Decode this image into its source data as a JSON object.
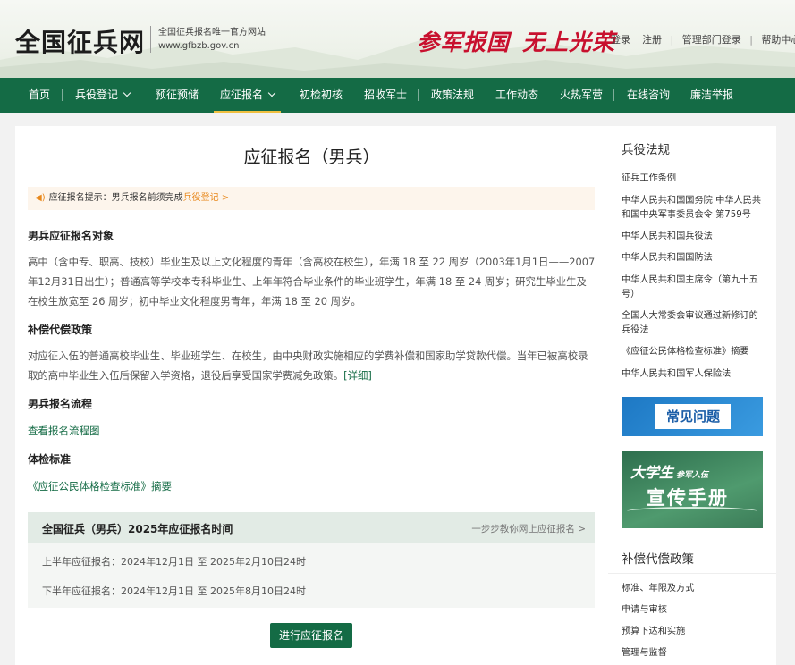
{
  "header": {
    "site_title": "全国征兵网",
    "site_sub1": "全国征兵报名唯一官方网站",
    "site_sub2": "www.gfbzb.gov.cn",
    "slogan_a": "参军报国",
    "slogan_b": "无上光荣",
    "links": {
      "login": "登录",
      "register": "注册",
      "admin_login": "管理部门登录",
      "help": "帮助中心",
      "sep": "|"
    }
  },
  "nav": {
    "home": "首页",
    "registration": "兵役登记",
    "pre_reserve": "预征预储",
    "apply": "应征报名",
    "exam": "初检初核",
    "recruit_officer": "招收军士",
    "policy": "政策法规",
    "work_news": "工作动态",
    "barracks": "火热军营",
    "consult": "在线咨询",
    "integrity": "廉洁举报"
  },
  "main": {
    "title": "应征报名（男兵）",
    "notice_prefix": "应征报名提示：男兵报名前须完成",
    "notice_link": "兵役登记 >",
    "s1_title": "男兵应征报名对象",
    "s1_text": "高中（含中专、职高、技校）毕业生及以上文化程度的青年（含高校在校生），年满 18 至 22 周岁（2003年1月1日——2007年12月31日出生）；普通高等学校本专科毕业生、上年年符合毕业条件的毕业班学生，年满 18 至 24 周岁；研究生毕业生及在校生放宽至 26 周岁；初中毕业文化程度男青年，年满 18 至 20 周岁。",
    "s2_title": "补偿代偿政策",
    "s2_text": "对应征入伍的普通高校毕业生、毕业班学生、在校生，由中央财政实施相应的学费补偿和国家助学贷款代偿。当年已被高校录取的高中毕业生入伍后保留入学资格，退役后享受国家学费减免政策。",
    "s2_more": "[详细]",
    "s3_title": "男兵报名流程",
    "s3_link": "查看报名流程图",
    "s4_title": "体检标准",
    "s4_link": "《应征公民体格检查标准》摘要",
    "time_box": {
      "title": "全国征兵（男兵）2025年应征报名时间",
      "guide_link": "一步步教你网上应征报名 >",
      "first_half": "上半年应征报名：2024年12月1日 至 2025年2月10日24时",
      "second_half": "下半年应征报名：2024年12月1日 至 2025年8月10日24时"
    },
    "apply_button": "进行应征报名"
  },
  "sidebar": {
    "laws_title": "兵役法规",
    "laws": [
      "征兵工作条例",
      "中华人民共和国国务院 中华人民共和国中央军事委员会令 第759号",
      "中华人民共和国兵役法",
      "中华人民共和国国防法",
      "中华人民共和国主席令（第九十五号）",
      "全国人大常委会审议通过新修订的兵役法",
      "《应征公民体格检查标准》摘要",
      "中华人民共和国军人保险法"
    ],
    "faq_banner": "常见问题",
    "handbook_l1": "大学生",
    "handbook_l1b": "参军入伍",
    "handbook_l2": "宣传手册",
    "comp_title": "补偿代偿政策",
    "comp": [
      "标准、年限及方式",
      "申请与审核",
      "预算下达和实施",
      "管理与监督"
    ]
  },
  "colors": {
    "nav_bg": "#146b45",
    "accent_red": "#c8102e",
    "link_green": "#146b45",
    "notice_orange": "#e8881c"
  }
}
